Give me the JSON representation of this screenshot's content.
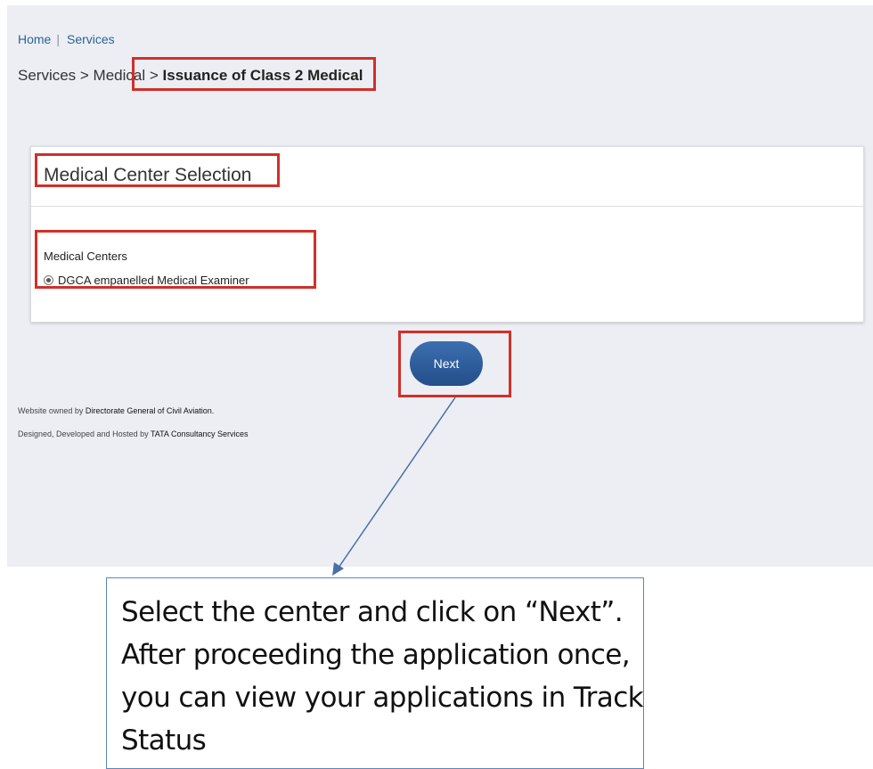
{
  "topnav": {
    "home": "Home",
    "separator": "|",
    "services": "Services"
  },
  "breadcrumb": {
    "path": "Services > Medical",
    "arrow": ">",
    "current": "Issuance of Class 2 Medical"
  },
  "card": {
    "title": "Medical Center Selection",
    "field_label": "Medical Centers",
    "option_label": "DGCA empanelled Medical Examiner",
    "option_selected": true
  },
  "next_label": "Next",
  "footer": {
    "owned_prefix": "Website owned by ",
    "owned_org": "Directorate General of Civil Aviation.",
    "hosted_prefix": "Designed, Developed and Hosted by ",
    "hosted_org": "TATA Consultancy Services"
  },
  "note": {
    "text": "Select the center and click on “Next”. After proceeding the application once, you can view your applications in Track Status"
  },
  "colors": {
    "highlight": "#d0302a",
    "button": "#2f5f9f",
    "link": "#2a6496",
    "background": "#eceef3"
  }
}
